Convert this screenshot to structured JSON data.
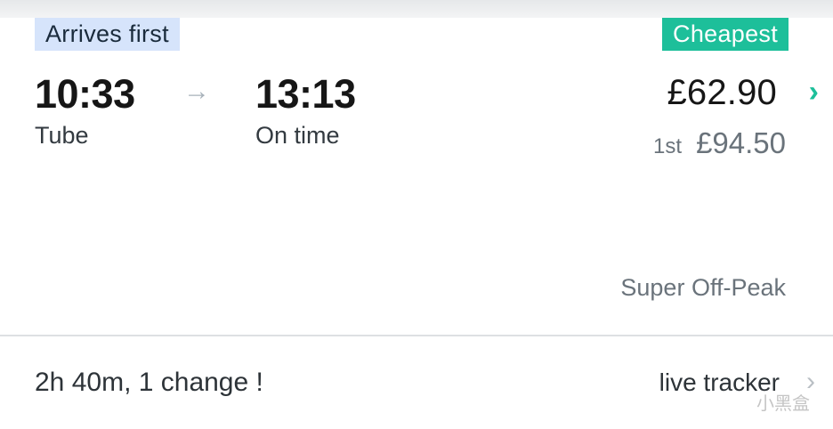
{
  "journey": {
    "tag_left": "Arrives first",
    "tag_right": "Cheapest",
    "departure": {
      "time": "10:33",
      "mode": "Tube"
    },
    "arrival": {
      "time": "13:13",
      "status": "On time"
    },
    "arrow": "→",
    "price_standard": "£62.90",
    "first_class_label": "1st",
    "price_first": "£94.50",
    "ticket_type": "Super Off-Peak",
    "chevron": "›"
  },
  "footer": {
    "summary": "2h 40m, 1 change !",
    "live_tracker_label": "live tracker",
    "chevron": "›"
  },
  "watermark": "小黑盒",
  "colors": {
    "arrives_first_bg": "#d6e4fb",
    "cheapest_bg": "#1dbf9a",
    "accent": "#1dbf9a"
  }
}
